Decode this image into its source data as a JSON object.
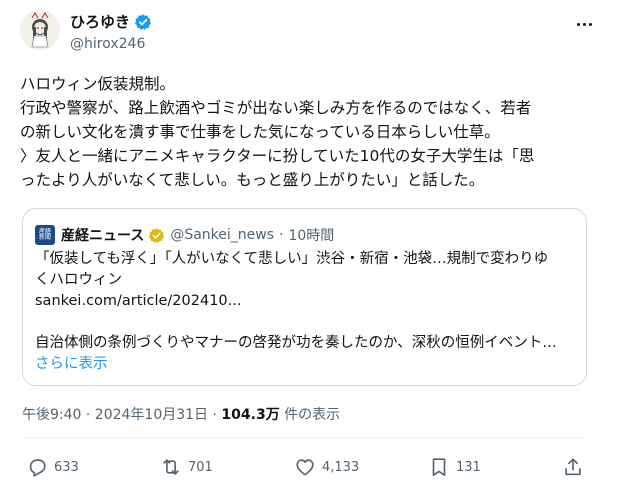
{
  "author": {
    "display_name": "ひろゆき",
    "handle": "@hirox246"
  },
  "body_lines": [
    "ハロウィン仮装規制。",
    "行政や警察が、路上飲酒やゴミが出ない楽しみ方を作るのではなく、若者",
    "の新しい文化を潰す事で仕事をした気になっている日本らしい仕草。",
    "〉友人と一緒にアニメキャラクターに扮していた10代の女子大学生は「思",
    "ったより人がいなくて悲しい。もっと盛り上がりたい」と話した。"
  ],
  "quote": {
    "logo_text": "産経新聞",
    "name": "産経ニュース",
    "handle": "@Sankei_news",
    "separator": "·",
    "time": "10時間",
    "lines": [
      "「仮装しても浮く」「人がいなくて悲しい」渋谷・新宿・池袋…規制で変わりゆ",
      "くハロウィン",
      "sankei.com/article/202410...",
      "自治体側の条例づくりやマナーの啓発が功を奏したのか、深秋の恒例イベント…"
    ],
    "show_more": "さらに表示"
  },
  "timestamp": {
    "time_date": "午後9:40 · 2024年10月31日 · ",
    "views": "104.3万",
    "views_suffix": " 件の表示"
  },
  "actions": {
    "replies": "633",
    "reposts": "701",
    "likes": "4,133",
    "bookmarks": "131"
  },
  "colors": {
    "text": "#0f1419",
    "secondary": "#536471",
    "link": "#1d9bf0",
    "border": "#cfd9de",
    "verified": "#1d9bf0",
    "quote_verified": "#e2b719"
  },
  "icons": [
    "more-icon",
    "verified-icon",
    "reply-icon",
    "repost-icon",
    "like-icon",
    "bookmark-icon",
    "share-icon"
  ]
}
